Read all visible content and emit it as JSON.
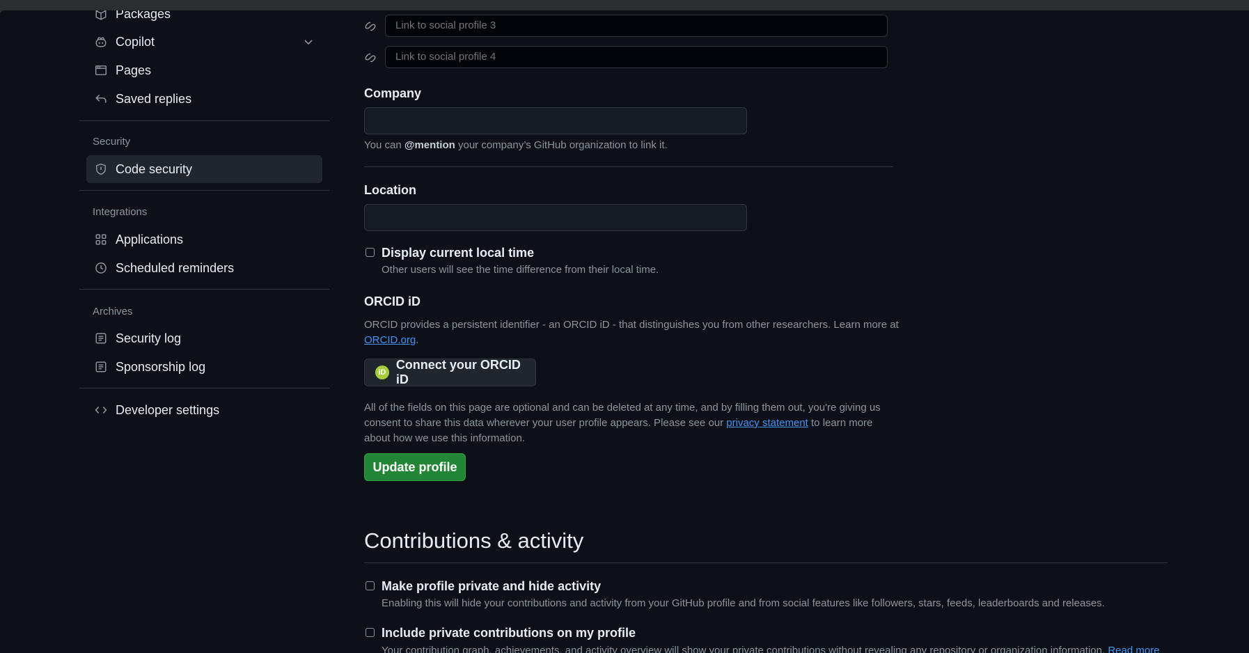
{
  "sidebar": {
    "items_top": [
      {
        "label": "Packages",
        "icon": "package-icon"
      },
      {
        "label": "Copilot",
        "icon": "copilot-icon"
      },
      {
        "label": "Pages",
        "icon": "browser-icon"
      },
      {
        "label": "Saved replies",
        "icon": "reply-icon"
      }
    ],
    "security_group": "Security",
    "code_security": "Code security",
    "integrations_group": "Integrations",
    "applications": "Applications",
    "scheduled_reminders": "Scheduled reminders",
    "archives_group": "Archives",
    "security_log": "Security log",
    "sponsorship_log": "Sponsorship log",
    "developer_settings": "Developer settings"
  },
  "profile": {
    "social3_placeholder": "Link to social profile 3",
    "social4_placeholder": "Link to social profile 4",
    "company_label": "Company",
    "company_value": "",
    "company_note_pre": "You can ",
    "company_note_mention": "@mention",
    "company_note_post": " your company’s GitHub organization to link it.",
    "location_label": "Location",
    "location_value": "",
    "local_time_label": "Display current local time",
    "local_time_desc": "Other users will see the time difference from their local time.",
    "orcid_title": "ORCID iD",
    "orcid_desc": "ORCID provides a persistent identifier - an ORCID iD - that distinguishes you from other researchers. Learn more at",
    "orcid_link": "ORCID.org",
    "orcid_button": "Connect your ORCID iD",
    "orcid_logo_text": "iD",
    "privacy_pre": "All of the fields on this page are optional and can be deleted at any time, and by filling them out, you're giving us consent to share this data wherever your user profile appears. Please see our ",
    "privacy_link": "privacy statement",
    "privacy_post": " to learn more about how we use this information.",
    "update_button": "Update profile"
  },
  "contributions": {
    "title": "Contributions & activity",
    "private_label": "Make profile private and hide activity",
    "private_desc": "Enabling this will hide your contributions and activity from your GitHub profile and from social features like followers, stars, feeds, leaderboards and releases.",
    "include_label": "Include private contributions on my profile",
    "include_desc": "Your contribution graph, achievements, and activity overview will show your private contributions without revealing any repository or organization information.",
    "read_more": "Read more"
  }
}
